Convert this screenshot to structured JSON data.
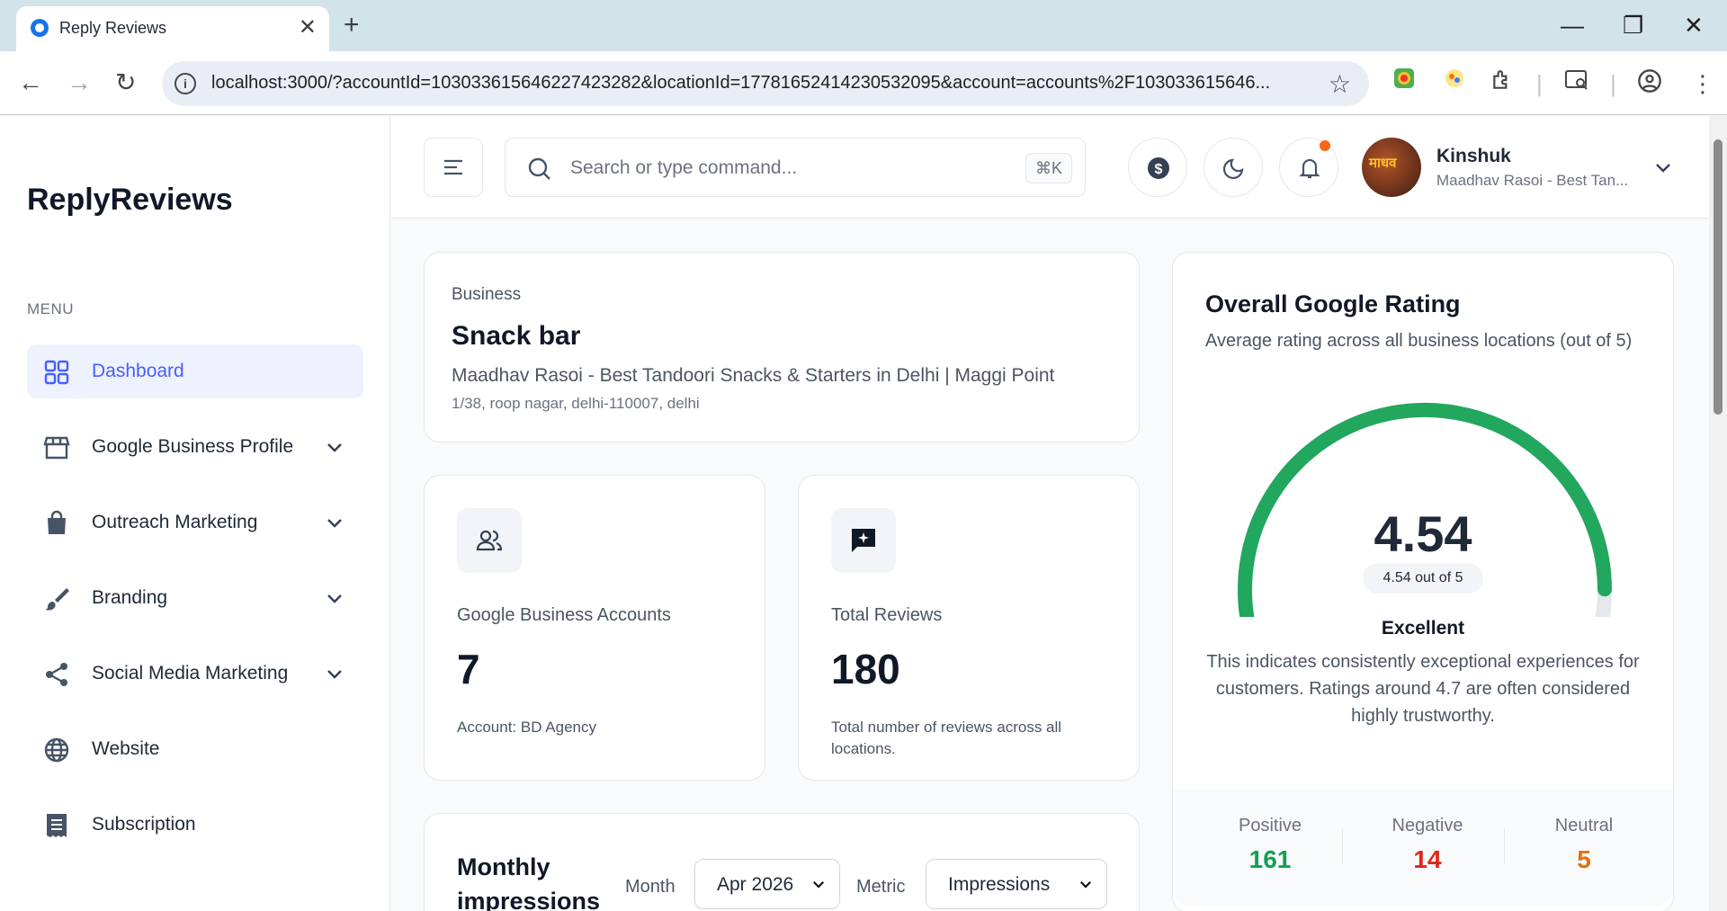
{
  "browser": {
    "tab_title": "Reply Reviews",
    "url": "localhost:3000/?accountId=103033615646227423282&locationId=17781652414230532095&account=accounts%2F103033615646..."
  },
  "sidebar": {
    "brand": "ReplyReviews",
    "menu_label": "MENU",
    "items": [
      {
        "label": "Dashboard",
        "icon": "grid-icon",
        "active": true
      },
      {
        "label": "Google Business Profile",
        "icon": "storefront-icon"
      },
      {
        "label": "Outreach Marketing",
        "icon": "shopping-bag-icon"
      },
      {
        "label": "Branding",
        "icon": "brush-icon"
      },
      {
        "label": "Social Media Marketing",
        "icon": "share-icon"
      },
      {
        "label": "Website",
        "icon": "globe-icon"
      },
      {
        "label": "Subscription",
        "icon": "receipt-icon"
      }
    ]
  },
  "header": {
    "search_placeholder": "Search or type command...",
    "shortcut": "⌘K",
    "user_name": "Kinshuk",
    "user_sub": "Maadhav Rasoi - Best Tan...",
    "avatar_text": "माधव"
  },
  "business": {
    "label": "Business",
    "type": "Snack bar",
    "name": "Maadhav Rasoi - Best Tandoori Snacks & Starters in Delhi | Maggi Point",
    "address": "1/38, roop nagar, delhi-110007, delhi"
  },
  "stats": {
    "accounts": {
      "label": "Google Business Accounts",
      "value": "7",
      "sub": "Account: BD Agency"
    },
    "reviews": {
      "label": "Total Reviews",
      "value": "180",
      "sub": "Total number of reviews across all locations."
    }
  },
  "rating": {
    "title": "Overall Google Rating",
    "subtitle": "Average rating across all business locations (out of 5)",
    "value": "4.54",
    "value_fraction": 0.908,
    "badge": "4.54 out of 5",
    "verdict": "Excellent",
    "description": "This indicates consistently exceptional experiences for customers. Ratings around 4.7 are often considered highly trustworthy.",
    "positive_label": "Positive",
    "positive": "161",
    "negative_label": "Negative",
    "negative": "14",
    "neutral_label": "Neutral",
    "neutral": "5",
    "colors": {
      "gauge": "#22a75e",
      "track": "#e4e7ec",
      "positive": "#12a150",
      "negative": "#e0261c",
      "neutral": "#e7700d"
    }
  },
  "monthly": {
    "title": "Monthly impressions",
    "month_label": "Month",
    "month_value": "Apr 2026",
    "metric_label": "Metric",
    "metric_value": "Impressions"
  }
}
